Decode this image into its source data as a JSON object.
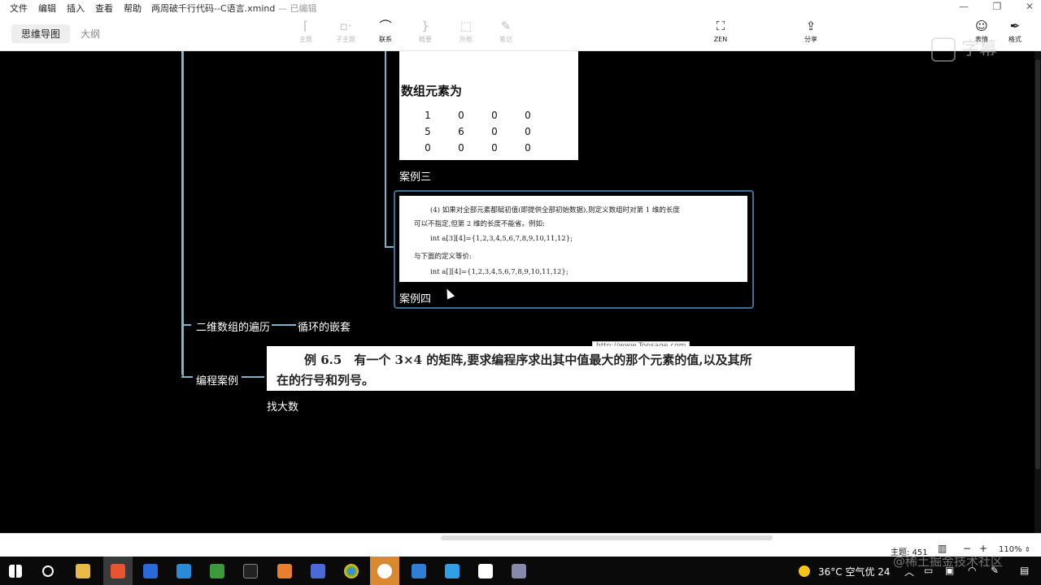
{
  "titlebar": {
    "menu": [
      "文件",
      "编辑",
      "插入",
      "查看",
      "帮助"
    ],
    "document": "两周破千行代码--C语言.xmind",
    "status": "— 已编辑"
  },
  "toolbar": {
    "view_tabs": [
      "思维导图",
      "大纲"
    ],
    "tools": [
      {
        "label": "主题",
        "icon": "topic-icon"
      },
      {
        "label": "子主题",
        "icon": "subtopic-icon"
      },
      {
        "label": "联系",
        "icon": "relationship-icon"
      },
      {
        "label": "概要",
        "icon": "summary-icon"
      },
      {
        "label": "外框",
        "icon": "boundary-icon"
      },
      {
        "label": "笔记",
        "icon": "notes-icon"
      },
      {
        "label": "ZEN",
        "icon": "zen-icon"
      },
      {
        "label": "分享",
        "icon": "share-icon"
      },
      {
        "label": "表情",
        "icon": "emoji-icon"
      },
      {
        "label": "格式",
        "icon": "format-icon"
      }
    ]
  },
  "canvas": {
    "card3": {
      "heading": "数组元素为",
      "matrix": [
        [
          "1",
          "0",
          "0",
          "0"
        ],
        [
          "5",
          "6",
          "0",
          "0"
        ],
        [
          "0",
          "0",
          "0",
          "0"
        ]
      ],
      "caption": "案例三"
    },
    "card4": {
      "lines": [
        "(4) 如果对全部元素都赋初值(即提供全部初始数据),则定义数组时对第 1 维的长度",
        "可以不指定,但第 2 维的长度不能省。例如:",
        "int a[3][4]={1,2,3,4,5,6,7,8,9,10,11,12};",
        "与下面的定义等价:",
        "int a[][4]={1,2,3,4,5,6,7,8,9,10,11,12};"
      ],
      "caption": "案例四"
    },
    "topic_traverse": "二维数组的遍历",
    "topic_loop": "循环的嵌套",
    "url_tip": "http://www.Topsage.com",
    "card5": {
      "line1": "例 6.5　有一个 3×4 的矩阵,要求编程序求出其中值最大的那个元素的值,以及其所",
      "line2": "在的行号和列号。"
    },
    "topic_programming": "编程案例",
    "caption_find_max": "找大数"
  },
  "statusbar": {
    "topic_count": "主题: 451",
    "zoom": "110%"
  },
  "taskbar": {
    "weather": "36°C 空气优 24",
    "watermark": "@稀土掘金技术社区"
  }
}
